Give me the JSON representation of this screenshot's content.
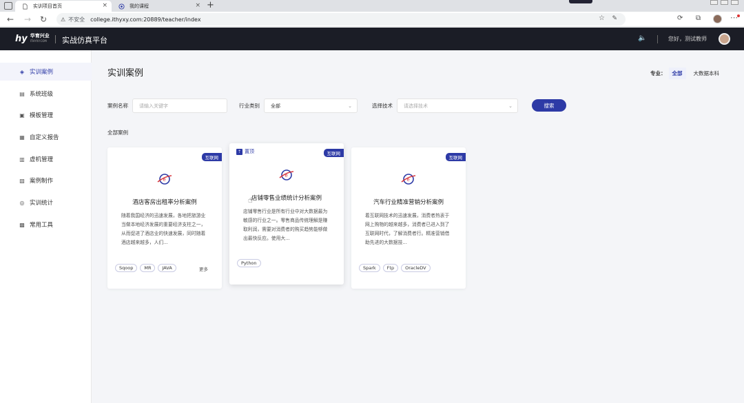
{
  "browser": {
    "tabs": [
      {
        "title": "实训项目首页",
        "active": true
      },
      {
        "title": "我的课程",
        "active": false
      }
    ],
    "new_tab": "+",
    "security_icon": "warning-icon",
    "security_text": "不安全",
    "url": "college.ithyxy.com:20889/teacher/index"
  },
  "app": {
    "logo_mark": "hy",
    "logo_cn": "华育兴业",
    "logo_en": "ITHYXY.COM",
    "platform_title": "实战仿真平台",
    "greeting": "您好，测试教师"
  },
  "sidebar": {
    "items": [
      {
        "label": "实训案例",
        "icon": "layers-icon",
        "active": true
      },
      {
        "label": "系统班级",
        "icon": "class-icon",
        "active": false
      },
      {
        "label": "模板管理",
        "icon": "template-icon",
        "active": false
      },
      {
        "label": "自定义报告",
        "icon": "report-icon",
        "active": false
      },
      {
        "label": "虚机管理",
        "icon": "vm-icon",
        "active": false
      },
      {
        "label": "案例制作",
        "icon": "case-make-icon",
        "active": false
      },
      {
        "label": "实训统计",
        "icon": "stats-icon",
        "active": false
      },
      {
        "label": "常用工具",
        "icon": "tools-icon",
        "active": false
      }
    ]
  },
  "main": {
    "title": "实训案例",
    "major_label": "专业：",
    "major_options": [
      {
        "label": "全部",
        "selected": true
      },
      {
        "label": "大数据本科",
        "selected": false
      }
    ],
    "filters": {
      "case_name_label": "案例名称",
      "case_name_placeholder": "请输入关键字",
      "industry_label": "行业类别",
      "industry_value": "全部",
      "tech_label": "选择技术",
      "tech_placeholder": "请选择技术",
      "search_button": "搜索"
    },
    "all_label": "全部案例",
    "cards": [
      {
        "badge": "互联网",
        "pinned": false,
        "title": "酒店客房出租率分析案例",
        "desc": "随着我国经济的迅速发展，各地把旅游业当做本地经济发展的重要经济支柱之一，从而促进了酒店业的快速发展，同时随着酒店越来越多，人们...",
        "tags": [
          "Sqoop",
          "MR",
          "JAVA"
        ],
        "more": "更多"
      },
      {
        "badge": "互联网",
        "pinned": true,
        "pin_label": "置顶",
        "title": "店铺零售业绩统计分析案例",
        "desc": "店铺零售行业是所有行业中对大数据最为敏感的行业之一。零售商品传统理解是赚取利润，需要对消费者的购买趋势能够做出最快反应。使用大...",
        "tags": [
          "Python"
        ]
      },
      {
        "badge": "互联网",
        "pinned": false,
        "title": "汽车行业精准营销分析案例",
        "desc": "着互联网技术的迅速发展，消费者热衷于网上购物的越来越多，消费者已进入到了互联网时代，了解消费者行。精准营销借助先进的大数据技...",
        "tags": [
          "Spark",
          "Ftp",
          "OracleDV"
        ]
      }
    ]
  },
  "colors": {
    "accent": "#2d3aa6",
    "header_bg": "#1b1d26",
    "card_icon_red": "#d8383f"
  }
}
